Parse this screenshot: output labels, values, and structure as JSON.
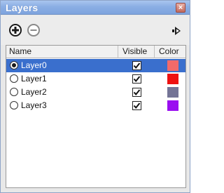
{
  "panel": {
    "title": "Layers",
    "close_label": "×"
  },
  "toolbar": {
    "add_icon": "add-layer-icon",
    "remove_icon": "remove-layer-icon",
    "details_icon": "details-arrow-icon"
  },
  "columns": {
    "name": "Name",
    "visible": "Visible",
    "color": "Color"
  },
  "layers": [
    {
      "name": "Layer0",
      "active": true,
      "visible": true,
      "color": "#f26a6a",
      "selected": true
    },
    {
      "name": "Layer1",
      "active": false,
      "visible": true,
      "color": "#ee1111",
      "selected": false
    },
    {
      "name": "Layer2",
      "active": false,
      "visible": true,
      "color": "#747496",
      "selected": false
    },
    {
      "name": "Layer3",
      "active": false,
      "visible": true,
      "color": "#9a0ef0",
      "selected": false
    }
  ],
  "colors": {
    "selection": "#3a6fcd",
    "titlebar": "#8aaee4"
  }
}
